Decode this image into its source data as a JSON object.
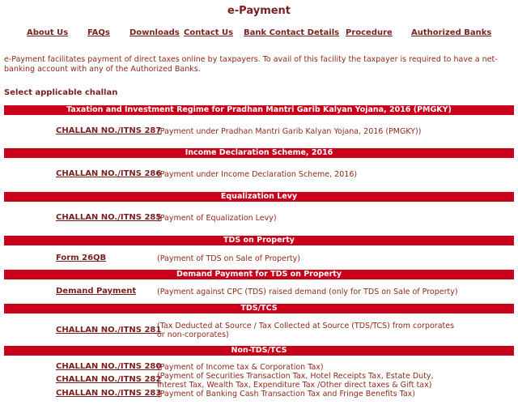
{
  "page_title": "e-Payment",
  "nav": {
    "about": "About Us",
    "faqs": "FAQs",
    "downloads": "Downloads",
    "contact": "Contact Us",
    "bank_contact": "Bank Contact Details",
    "procedure": "Procedure",
    "authorized_banks": "Authorized Banks"
  },
  "intro": "e-Payment facilitates payment of direct taxes online by taxpayers. To avail of this facility the taxpayer is required to have a net-banking account with any of the Authorized Banks.",
  "select_label": "Select applicable challan",
  "sections": {
    "pmgky": {
      "heading": "Taxation and Investment Regime for Pradhan Mantri Garib Kalyan Yojana, 2016 (PMGKY)",
      "link": "CHALLAN NO./ITNS 287",
      "desc": "(Payment under Pradhan Mantri Garib Kalyan Yojana, 2016 (PMGKY))"
    },
    "ids": {
      "heading": "Income Declaration Scheme, 2016",
      "link": "CHALLAN NO./ITNS 286",
      "desc": "(Payment under Income Declaration Scheme, 2016)"
    },
    "eq": {
      "heading": "Equalization Levy",
      "link": "CHALLAN NO./ITNS 285",
      "desc": "(Payment of Equalization Levy)"
    },
    "tdsprop": {
      "heading": "TDS on Property",
      "link": "Form 26QB",
      "desc": "(Payment of TDS on Sale of Property)"
    },
    "demand": {
      "heading": "Demand Payment for TDS on Property",
      "link": "Demand Payment",
      "desc": "(Payment against CPC (TDS) raised demand (only for TDS on Sale of Property)"
    },
    "tdstcs": {
      "heading": "TDS/TCS",
      "link": "CHALLAN NO./ITNS 281",
      "desc": "(Tax Deducted at Source / Tax Collected at Source (TDS/TCS) from corporates or non-corporates)"
    },
    "nontds": {
      "heading": "Non-TDS/TCS",
      "items": [
        {
          "link": "CHALLAN NO./ITNS 280",
          "desc": "(Payment of Income tax & Corporation Tax)"
        },
        {
          "link": "CHALLAN NO./ITNS 282",
          "desc": "(Payment of Securities Transaction Tax, Hotel Receipts Tax, Estate Duty, Interest Tax, Wealth Tax, Expenditure Tax /Other direct taxes & Gift tax)"
        },
        {
          "link": "CHALLAN NO./ITNS 283",
          "desc": "(Payment of Banking Cash Transaction Tax and Fringe Benefits Tax)"
        }
      ]
    }
  }
}
